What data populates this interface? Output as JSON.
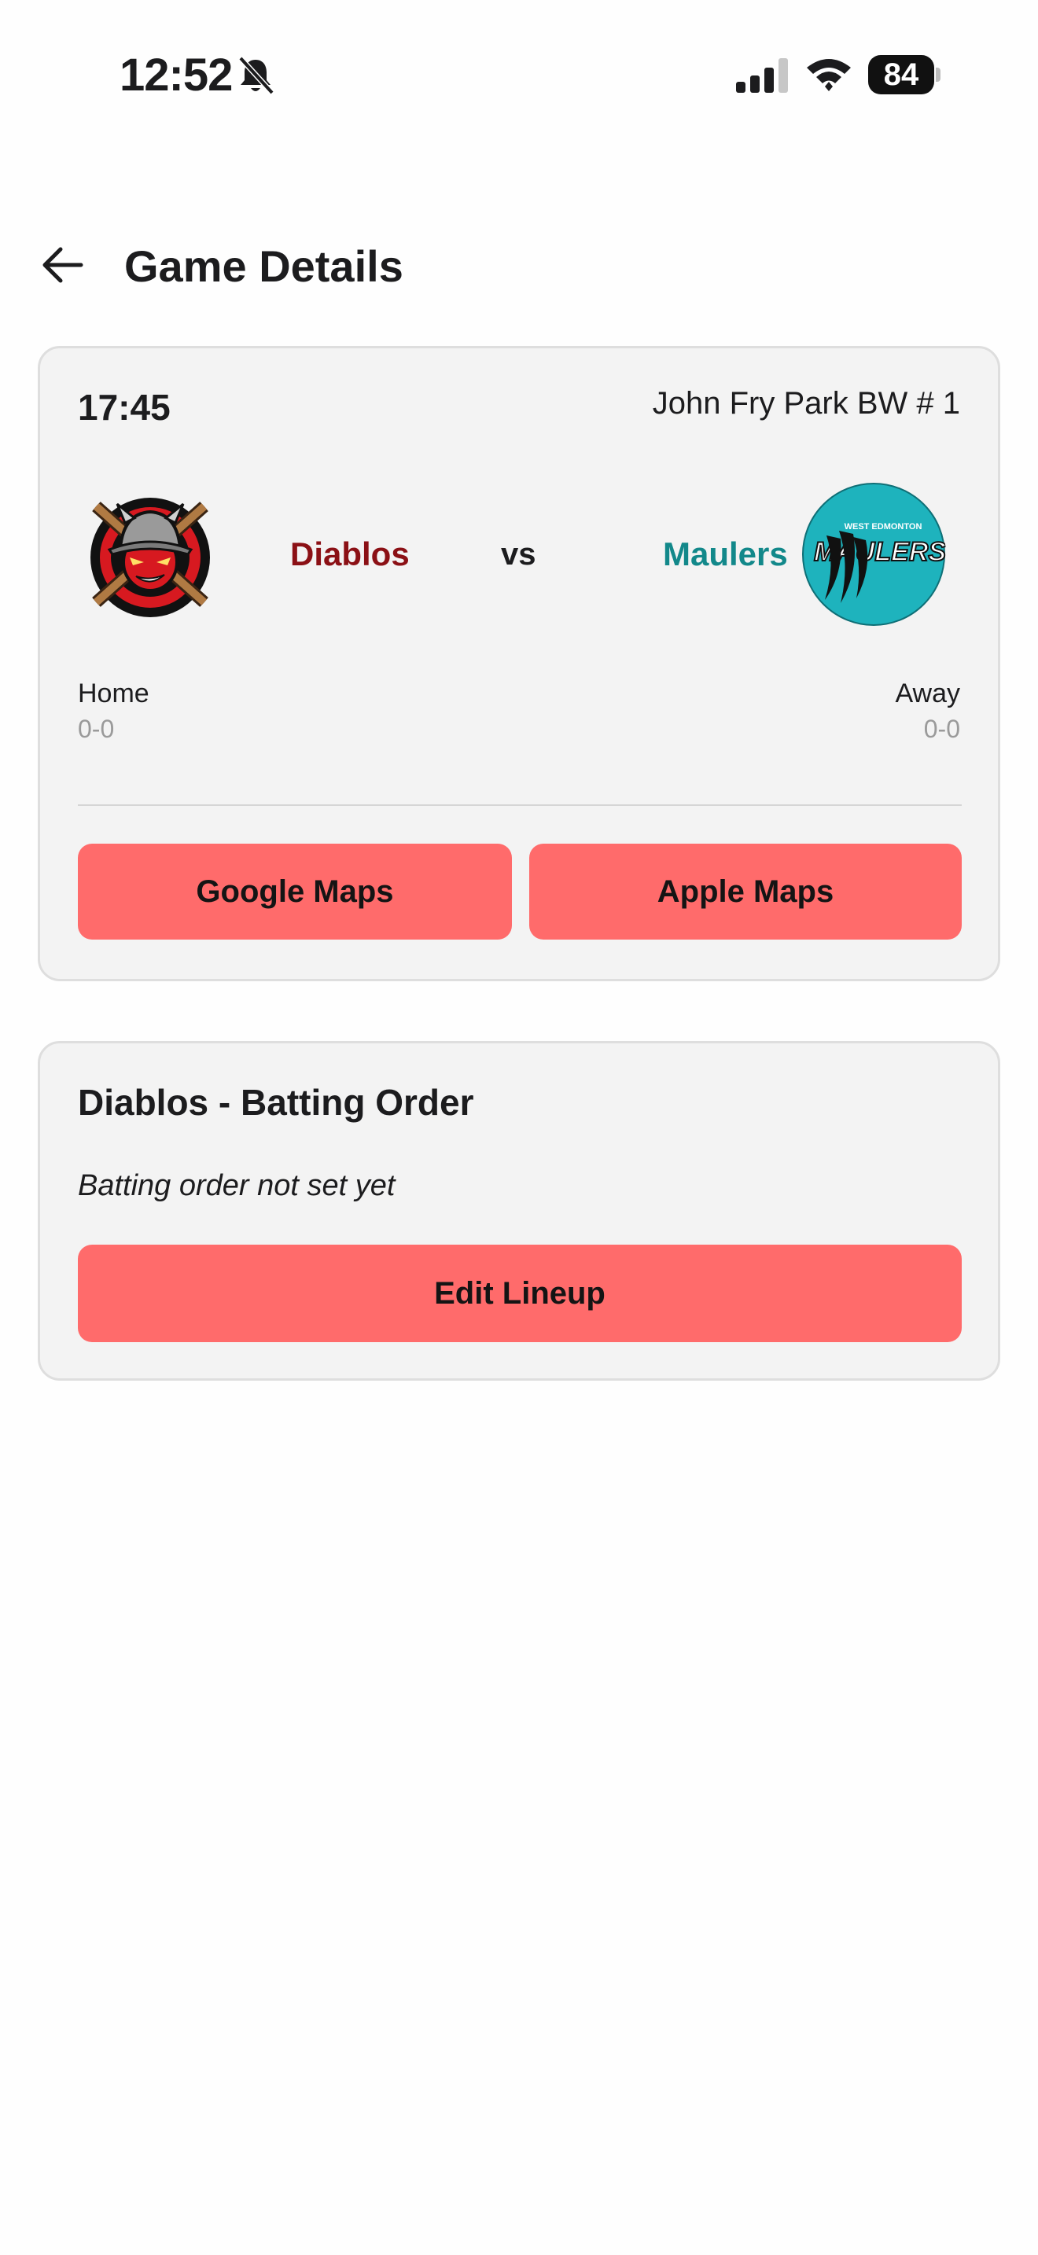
{
  "status_bar": {
    "time": "12:52",
    "battery": "84"
  },
  "header": {
    "title": "Game Details"
  },
  "game": {
    "time": "17:45",
    "venue": "John Fry Park BW # 1",
    "home": {
      "name": "Diablos",
      "role": "Home",
      "record": "0-0",
      "color": "#8b1015"
    },
    "away": {
      "name": "Maulers",
      "role": "Away",
      "record": "0-0",
      "color": "#12888a",
      "logo_text_top": "WEST EDMONTON",
      "logo_text_main": "MAULERS"
    },
    "vs": "vs",
    "google_maps": "Google Maps",
    "apple_maps": "Apple Maps"
  },
  "lineup": {
    "title": "Diablos - Batting Order",
    "status": "Batting order not set yet",
    "edit_label": "Edit Lineup"
  },
  "colors": {
    "accent": "#ff6b6b",
    "card": "#f3f3f3"
  }
}
